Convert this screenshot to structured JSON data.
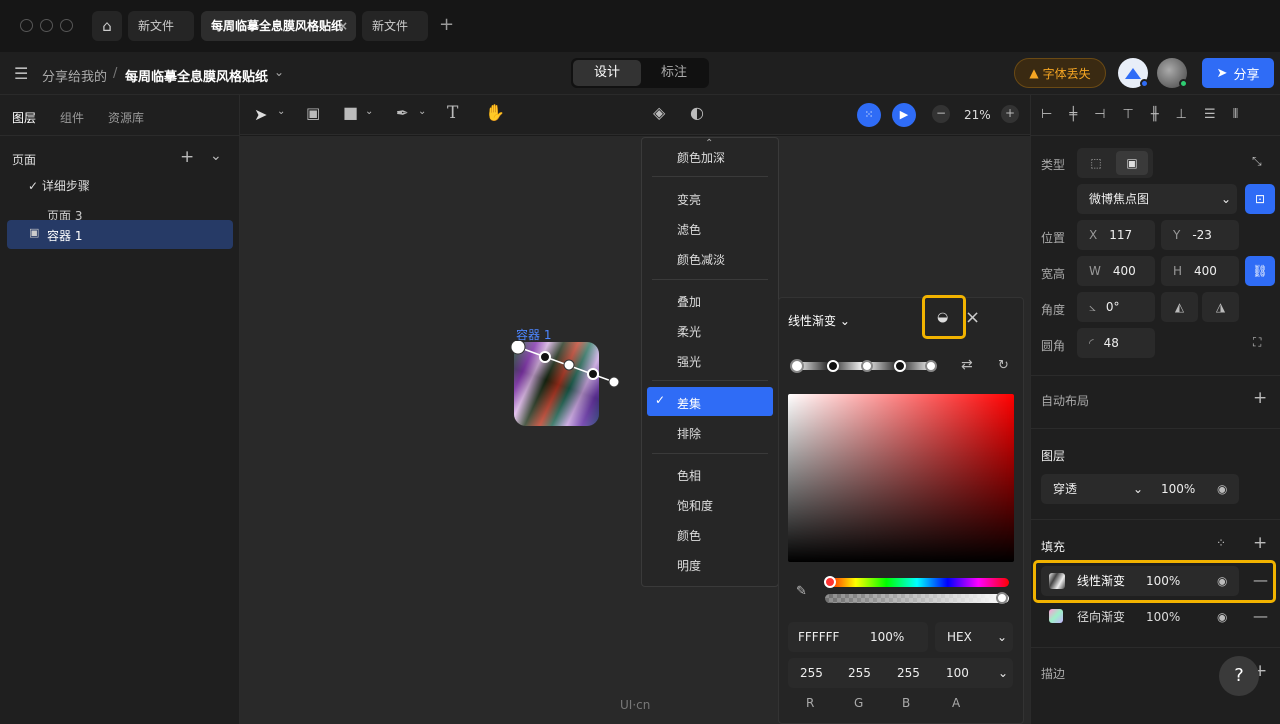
{
  "titlebar": {
    "tabs": [
      "新文件",
      "每周临摹全息膜风格贴纸",
      "新文件"
    ]
  },
  "header": {
    "breadcrumb_parent": "分享给我的",
    "breadcrumb_sep": "/",
    "file_name": "每周临摹全息膜风格贴纸",
    "mode_tabs": [
      "设计",
      "标注"
    ],
    "font_missing": "字体丢失",
    "share": "分享"
  },
  "left": {
    "tabs": [
      "图层",
      "组件",
      "资源库"
    ],
    "pages_title": "页面",
    "pages": [
      "详细步骤",
      "页面 3"
    ],
    "layer": "容器 1"
  },
  "toolbar": {
    "zoom": "21%"
  },
  "canvas": {
    "frame_label": "容器 1",
    "watermark": "UI·cn"
  },
  "blend_menu": {
    "items_top": [
      "颜色加深"
    ],
    "group2": [
      "变亮",
      "滤色",
      "颜色减淡"
    ],
    "group3": [
      "叠加",
      "柔光",
      "强光"
    ],
    "group4": [
      "差集",
      "排除"
    ],
    "group5": [
      "色相",
      "饱和度",
      "颜色",
      "明度"
    ],
    "selected": "差集"
  },
  "color_picker": {
    "type": "线性渐变",
    "hex": "FFFFFF",
    "opacity": "100%",
    "format": "HEX",
    "rgba": [
      "255",
      "255",
      "255",
      "100"
    ],
    "rgba_labels": [
      "R",
      "G",
      "B",
      "A"
    ]
  },
  "right": {
    "type_label": "类型",
    "preset": "微博焦点图",
    "pos_label": "位置",
    "x_label": "X",
    "x": "117",
    "y_label": "Y",
    "y": "-23",
    "size_label": "宽高",
    "w_label": "W",
    "w": "400",
    "h_label": "H",
    "h": "400",
    "angle_label": "角度",
    "angle": "0°",
    "radius_label": "圆角",
    "radius": "48",
    "auto_layout": "自动布局",
    "layer_title": "图层",
    "blend": "穿透",
    "layer_opacity": "100%",
    "fill_title": "填充",
    "fills": [
      {
        "name": "线性渐变",
        "opacity": "100%"
      },
      {
        "name": "径向渐变",
        "opacity": "100%"
      }
    ],
    "stroke_title": "描边",
    "help": "?"
  },
  "colors": {
    "accent": "#2f6cf6",
    "highlight": "#f2b300",
    "warning_bg": "#3a2a12",
    "warning_text": "#f6a623"
  }
}
